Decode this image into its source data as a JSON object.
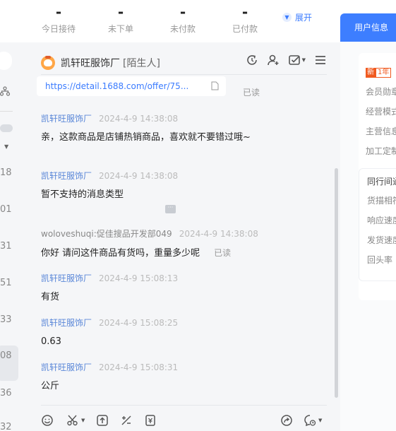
{
  "stats": [
    {
      "value": "-",
      "label": "今日接待"
    },
    {
      "value": "-",
      "label": "未下单"
    },
    {
      "value": "-",
      "label": "未付款"
    },
    {
      "value": "-",
      "label": "已付款"
    }
  ],
  "expand_label": "展开",
  "right_tab": "用户信息",
  "left_numbers": [
    "18",
    "01",
    "31",
    "51",
    "33",
    "08",
    "36",
    "32"
  ],
  "chat": {
    "shop_name": "凯轩旺服饰厂",
    "stranger_tag": "[陌生人]",
    "link_url": "https://detail.1688.com/offer/75...",
    "link_read": "已读",
    "messages": [
      {
        "sender": "凯轩旺服饰厂",
        "time": "2024-4-9 14:38:08",
        "text": "亲，这款商品是店铺热销商品，喜欢就不要错过哦~"
      },
      {
        "sender": "凯轩旺服饰厂",
        "time": "2024-4-9 14:38:08",
        "text": "暂不支持的消息类型"
      },
      {
        "sender": "woloveshuqi:促佳搜品开发部049",
        "time": "2024-4-9 14:38:08",
        "text": "你好 请问这件商品有货吗，重量多少呢",
        "read": "已读"
      },
      {
        "sender": "凯轩旺服饰厂",
        "time": "2024-4-9 15:08:13",
        "text": "有货"
      },
      {
        "sender": "凯轩旺服饰厂",
        "time": "2024-4-9 15:08:25",
        "text": "0.63"
      },
      {
        "sender": "凯轩旺服饰厂",
        "time": "2024-4-9 15:08:31",
        "text": "公斤"
      }
    ]
  },
  "right_panel": {
    "badge_new": "新",
    "badge_year": "1年",
    "rows": [
      "会员勋章",
      "经营模式",
      "主营信息",
      "加工定制"
    ],
    "peer_title": "同行间通",
    "peer_rows": [
      "货描相符",
      "响应速度",
      "发货速度",
      "回头率"
    ]
  },
  "colors": {
    "accent": "#3d7eff",
    "link": "#3a7bff",
    "sender": "#5a87d8"
  }
}
